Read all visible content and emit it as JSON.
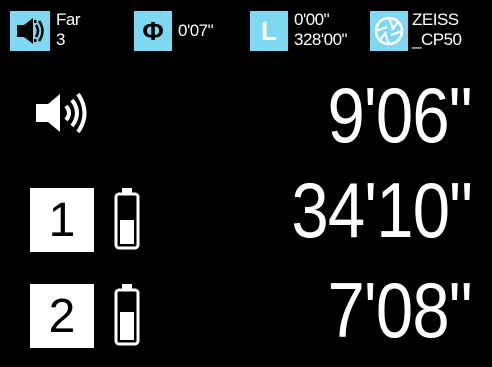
{
  "topbar": {
    "speaker_icon": "speaker-box-icon",
    "mode_label": "Far",
    "mode_value": "3",
    "diameter_icon": "phi-icon",
    "diameter_glyph": "Φ",
    "diameter_value": "0'07\"",
    "length_icon": "length-L-icon",
    "length_glyph": "L",
    "length_top": "0'00\"",
    "length_bottom": "328'00\"",
    "lens_icon": "lens-aperture-icon",
    "lens_brand": "ZEISS",
    "lens_model": "_CP50"
  },
  "main": {
    "volume_icon": "speaker-volume-icon",
    "primary_distance": "9'06\"",
    "channels": [
      {
        "label": "1",
        "battery_icon": "battery-icon",
        "distance": "34'10\""
      },
      {
        "label": "2",
        "battery_icon": "battery-icon",
        "distance": "7'08\""
      }
    ]
  }
}
